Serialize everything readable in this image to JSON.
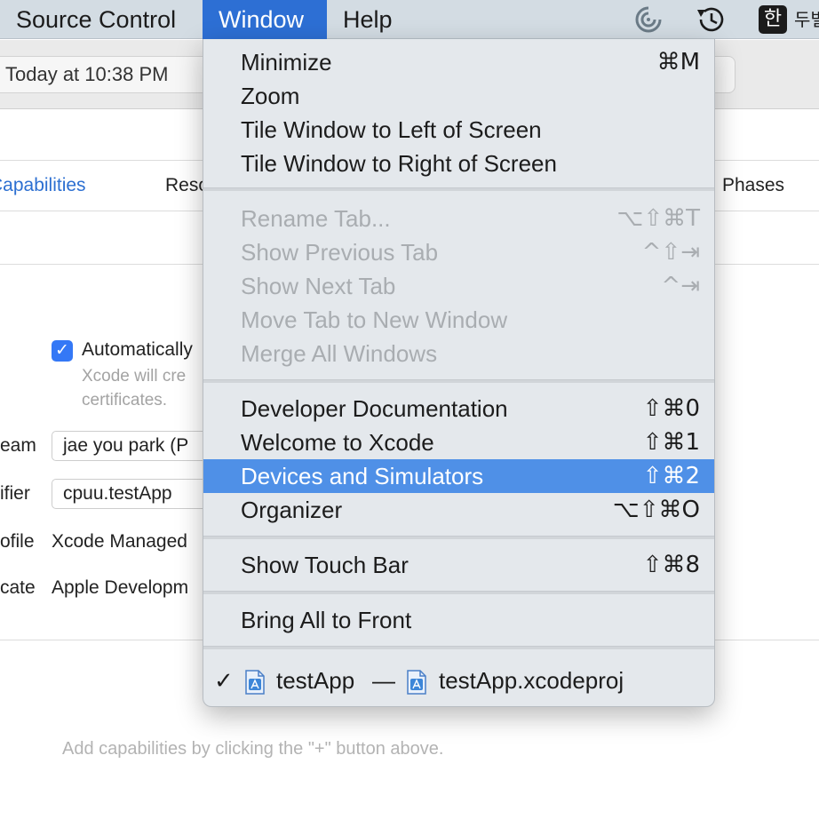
{
  "menubar": {
    "items": [
      "Source Control",
      "Window",
      "Help"
    ],
    "active_index": 1,
    "input_source": "두벌"
  },
  "toolbar": {
    "activity_text": "Today at 10:38 PM"
  },
  "editor": {
    "tabs": [
      "Capabilities",
      "Reso",
      "Phases"
    ],
    "auto_signing": {
      "label": "Automatically",
      "checked": true,
      "description_line1": "Xcode will cre",
      "description_line2": "certificates."
    },
    "rows": [
      {
        "label": "eam",
        "value": "jae you park (P"
      },
      {
        "label": "ifier",
        "value": "cpuu.testApp"
      },
      {
        "label": "ofile",
        "value": "Xcode Managed"
      },
      {
        "label": "cate",
        "value": "Apple Developm"
      }
    ],
    "empty_hint": "Add capabilities by clicking the \"+\" button above."
  },
  "window_menu": {
    "groups": [
      [
        {
          "label": "Minimize",
          "shortcut": "⌘M",
          "enabled": true
        },
        {
          "label": "Zoom",
          "shortcut": "",
          "enabled": true
        },
        {
          "label": "Tile Window to Left of Screen",
          "shortcut": "",
          "enabled": true
        },
        {
          "label": "Tile Window to Right of Screen",
          "shortcut": "",
          "enabled": true
        }
      ],
      [
        {
          "label": "Rename Tab...",
          "shortcut": "⌥⇧⌘T",
          "enabled": false
        },
        {
          "label": "Show Previous Tab",
          "shortcut": "^⇧⇥",
          "enabled": false
        },
        {
          "label": "Show Next Tab",
          "shortcut": "^⇥",
          "enabled": false
        },
        {
          "label": "Move Tab to New Window",
          "shortcut": "",
          "enabled": false
        },
        {
          "label": "Merge All Windows",
          "shortcut": "",
          "enabled": false
        }
      ],
      [
        {
          "label": "Developer Documentation",
          "shortcut": "⇧⌘0",
          "enabled": true
        },
        {
          "label": "Welcome to Xcode",
          "shortcut": "⇧⌘1",
          "enabled": true
        },
        {
          "label": "Devices and Simulators",
          "shortcut": "⇧⌘2",
          "enabled": true,
          "highlighted": true
        },
        {
          "label": "Organizer",
          "shortcut": "⌥⇧⌘O",
          "enabled": true
        }
      ],
      [
        {
          "label": "Show Touch Bar",
          "shortcut": "⇧⌘8",
          "enabled": true
        }
      ],
      [
        {
          "label": "Bring All to Front",
          "shortcut": "",
          "enabled": true
        }
      ]
    ],
    "window_entry": {
      "checked": true,
      "name": "testApp",
      "separator": "—",
      "project": "testApp.xcodeproj"
    }
  },
  "colors": {
    "accent": "#2d6fd4",
    "highlight": "#4f90e7",
    "menubar": "#d3dce3",
    "menu_bg": "#e4e8ec",
    "disabled_text": "#a9adb1"
  }
}
